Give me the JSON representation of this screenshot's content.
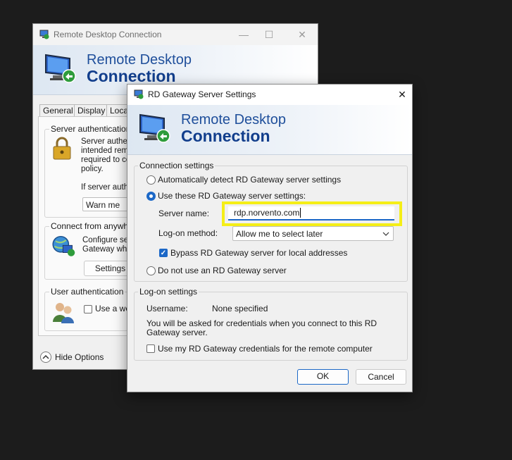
{
  "colors": {
    "accent": "#1c68c7",
    "highlight": "#f5ee17",
    "banner_text": "#123e8c"
  },
  "back_window": {
    "title": "Remote Desktop Connection",
    "icon": "rdc-app-icon",
    "controls": {
      "minimize": "—",
      "maximize": "☐",
      "close": "✕"
    },
    "banner": {
      "line1": "Remote Desktop",
      "line2": "Connection"
    },
    "tabs": [
      "General",
      "Display",
      "Local"
    ],
    "server_auth": {
      "title": "Server authentication",
      "text_lines": [
        "Server authe",
        "intended rem",
        "required to co",
        "policy."
      ],
      "if_text": "If server auth",
      "combo_value": "Warn me"
    },
    "connect_anywhere": {
      "title": "Connect from anywhere",
      "text_lines": [
        "Configure se",
        "Gateway whe"
      ],
      "settings_button": "Settings"
    },
    "user_auth": {
      "title": "User authentication",
      "checkbox_label": "Use a we"
    },
    "hide_options": "Hide Options"
  },
  "dialog": {
    "title": "RD Gateway Server Settings",
    "close": "✕",
    "banner": {
      "line1": "Remote Desktop",
      "line2": "Connection"
    },
    "connection_settings": {
      "title": "Connection settings",
      "radio_auto": "Automatically detect RD Gateway server settings",
      "radio_use": "Use these RD Gateway server settings:",
      "server_name_label": "Server name:",
      "server_name_value": "rdp.norvento.com",
      "logon_method_label": "Log-on method:",
      "logon_method_value": "Allow me to select later",
      "bypass_label": "Bypass RD Gateway server for local addresses",
      "radio_none": "Do not use an RD Gateway server",
      "selected_radio": "use",
      "bypass_checked": true
    },
    "logon_settings": {
      "title": "Log-on settings",
      "username_label": "Username:",
      "username_value": "None specified",
      "info_line1": "You will be asked for credentials when you connect to this RD",
      "info_line2": "Gateway server.",
      "use_credentials_label": "Use my RD Gateway credentials for the remote computer",
      "use_credentials_checked": false
    },
    "ok": "OK",
    "cancel": "Cancel"
  }
}
